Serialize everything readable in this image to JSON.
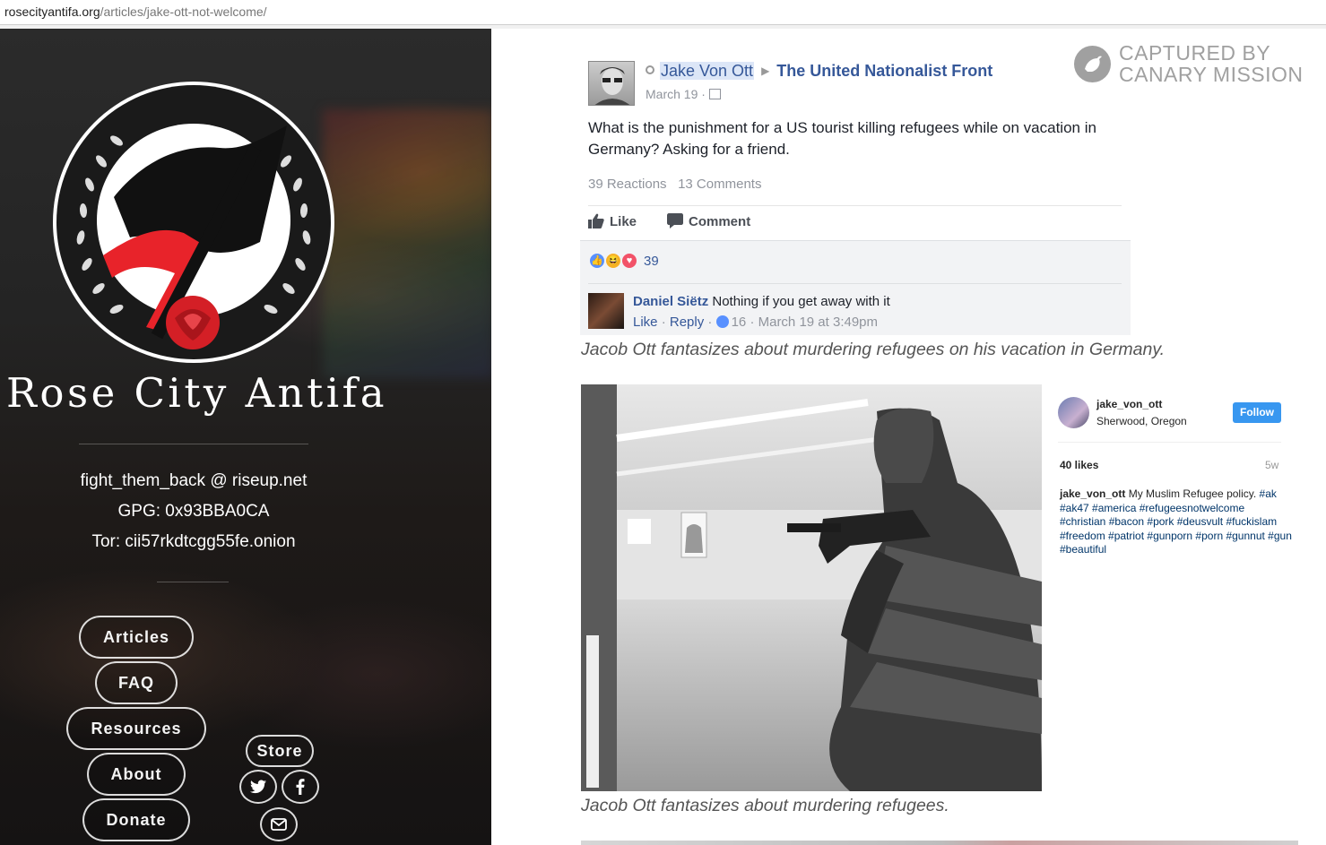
{
  "browser": {
    "url_host": "rosecityantifa.org",
    "url_path": "/articles/jake-ott-not-welcome/"
  },
  "sidebar": {
    "brand": "Rose City Antifa",
    "email": "fight_them_back @ riseup.net",
    "gpg": "GPG: 0x93BBA0CA",
    "tor": "Tor: cii57rkdtcgg55fe.onion",
    "nav": {
      "articles": "Articles",
      "faq": "FAQ",
      "resources": "Resources",
      "about": "About",
      "donate": "Donate",
      "store": "Store"
    },
    "social_icons": [
      "twitter-icon",
      "facebook-icon",
      "envelope-icon"
    ]
  },
  "watermark": {
    "line1": "CAPTURED BY",
    "line2": "CANARY MISSION"
  },
  "fb_post": {
    "author": "Jake Von Ott",
    "group": "The United Nationalist Front",
    "date": "March 19 ·",
    "text": "What is the punishment for a US tourist killing refugees while on vacation in Germany? Asking for a friend.",
    "reactions_count": "39 Reactions",
    "comments_count": "13 Comments",
    "like_label": "Like",
    "comment_label": "Comment",
    "reaction_total": "39",
    "comment": {
      "name": "Daniel Siëtz",
      "text": "Nothing if you get away with it",
      "like": "Like",
      "reply": "Reply",
      "likes": "16",
      "time": "· March 19 at 3:49pm"
    },
    "colors": {
      "link": "#365899",
      "muted": "#90949c"
    }
  },
  "captions": {
    "first": "Jacob Ott fantasizes about murdering refugees on his vacation in Germany.",
    "second": "Jacob Ott fantasizes about murdering refugees."
  },
  "instagram": {
    "username": "jake_von_ott",
    "location": "Sherwood, Oregon",
    "follow": "Follow",
    "likes": "40 likes",
    "ago": "5w",
    "caption_user": "jake_von_ott",
    "caption_text": "My Muslim Refugee policy.",
    "hashtags": "#ak #ak47 #america #refugeesnotwelcome #christian #bacon #pork #deusvult #fuckislam #freedom #patriot #gunporn #porn #gunnut #gun #beautiful",
    "colors": {
      "follow": "#3897f0",
      "tags": "#003569"
    }
  }
}
